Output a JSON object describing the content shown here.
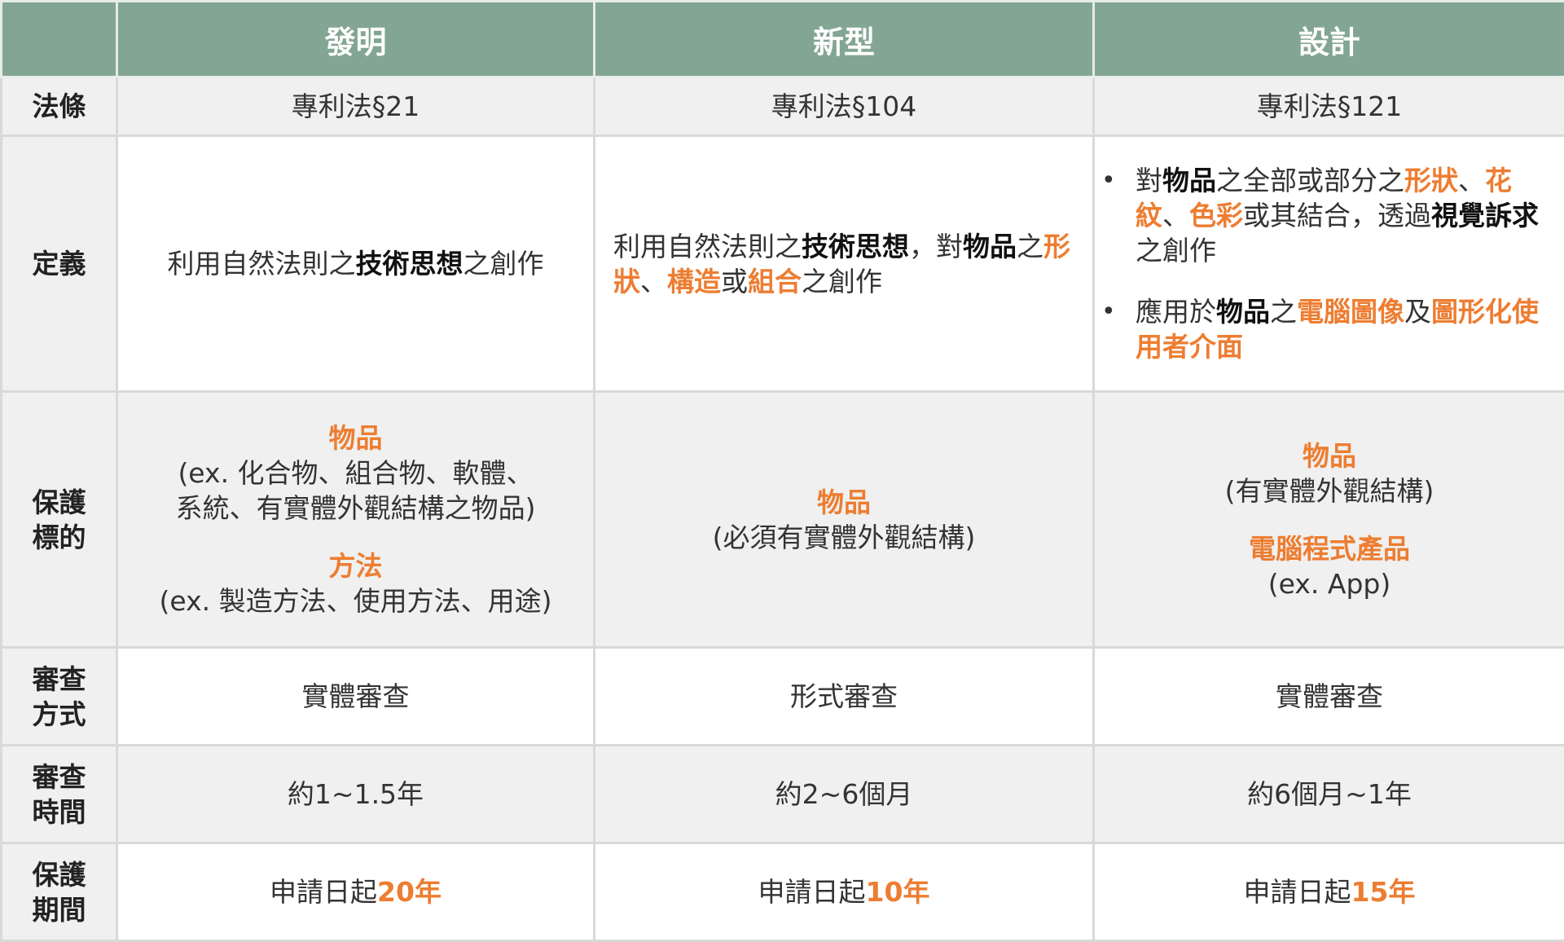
{
  "header": {
    "corner": "",
    "col1": "發明",
    "col2": "新型",
    "col3": "設計"
  },
  "rows": {
    "law": {
      "label": "法條",
      "c1": "專利法§21",
      "c2": "專利法§104",
      "c3": "專利法§121"
    },
    "definition": {
      "label": "定義",
      "c1": {
        "p1": "利用自然法則之",
        "b1": "技術思想",
        "p2": "之創作"
      },
      "c2": {
        "p1": "利用自然法則之",
        "b1": "技術思想",
        "p2": "，對",
        "b2": "物品",
        "p3": "之",
        "o1": "形狀",
        "p4": "、",
        "o2": "構造",
        "p5": "或",
        "o3": "組合",
        "p6": "之創作"
      },
      "c3": {
        "bullet1": {
          "bullet": "•",
          "p1": "對",
          "b1": "物品",
          "p2": "之全部或部分之",
          "o1": "形狀",
          "p3": "、",
          "o2": "花紋",
          "p4": "、",
          "o3": "色彩",
          "p5": "或其結合，透過",
          "b2": "視覺訴求",
          "p6": "之創作"
        },
        "bullet2": {
          "bullet": "•",
          "p1": "應用於",
          "b1": "物品",
          "p2": "之",
          "o1": "電腦圖像",
          "p3": "及",
          "o2": "圖形化使用者介面"
        }
      }
    },
    "subject": {
      "label": "保護標的",
      "c1": {
        "o1": "物品",
        "t1a": "(ex. 化合物、組合物、軟體、",
        "t1b": "系統、有實體外觀結構之物品)",
        "o2": "方法",
        "t2": "(ex. 製造方法、使用方法、用途)"
      },
      "c2": {
        "o1": "物品",
        "t1": "(必須有實體外觀結構)"
      },
      "c3": {
        "o1": "物品",
        "t1": "(有實體外觀結構)",
        "o2": "電腦程式產品",
        "t2": "(ex. App)"
      }
    },
    "exam_method": {
      "label": "審查方式",
      "c1": "實體審查",
      "c2": "形式審查",
      "c3": "實體審查"
    },
    "exam_time": {
      "label": "審查時間",
      "c1": "約1~1.5年",
      "c2": "約2~6個月",
      "c3": "約6個月~1年"
    },
    "term": {
      "label": "保護期間",
      "c1": {
        "p": "申請日起",
        "o": "20年"
      },
      "c2": {
        "p": "申請日起",
        "o": "10年"
      },
      "c3": {
        "p": "申請日起",
        "o": "15年"
      }
    }
  },
  "colors": {
    "header_bg": "#83a594",
    "accent": "#ed7d31",
    "shade": "#f0f0f0",
    "border": "#d9d9d9"
  }
}
